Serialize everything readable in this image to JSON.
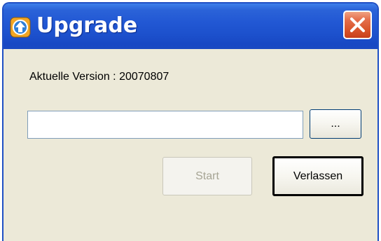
{
  "window": {
    "title": "Upgrade"
  },
  "content": {
    "version_label": "Aktuelle Version : 20070807",
    "path_value": "",
    "browse_label": "...",
    "start_label": "Start",
    "exit_label": "Verlassen"
  },
  "icons": {
    "app": "upgrade-arrow-icon",
    "close": "close-icon"
  },
  "colors": {
    "titlebar": "#2258d4",
    "window_bg": "#ece9d8",
    "close_button": "#d8532a",
    "disabled_text": "#a6a494"
  }
}
